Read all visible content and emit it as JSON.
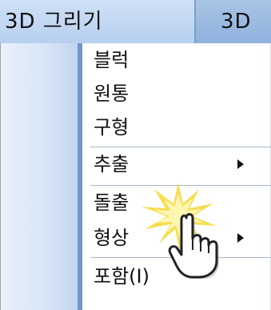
{
  "menubar": {
    "active_label": "3D 그리기",
    "next_label": "3D"
  },
  "menu": {
    "items": [
      {
        "label": "블럭",
        "has_submenu": false
      },
      {
        "label": "원통",
        "has_submenu": false
      },
      {
        "label": "구형",
        "has_submenu": false
      },
      {
        "label": "추출",
        "has_submenu": true
      },
      {
        "label": "돌출",
        "has_submenu": false
      },
      {
        "label": "형상",
        "has_submenu": true
      },
      {
        "label": "포함(I)",
        "has_submenu": false
      }
    ]
  },
  "icons": {
    "cursor": "hand-pointer-icon",
    "burst": "click-burst-icon",
    "submenu": "submenu-arrow-icon"
  },
  "colors": {
    "menubar": "#9bb8df",
    "active_menu": "#c3d8f3",
    "gutter_edge": "#6f97cc",
    "burst": "#f3d23a"
  }
}
